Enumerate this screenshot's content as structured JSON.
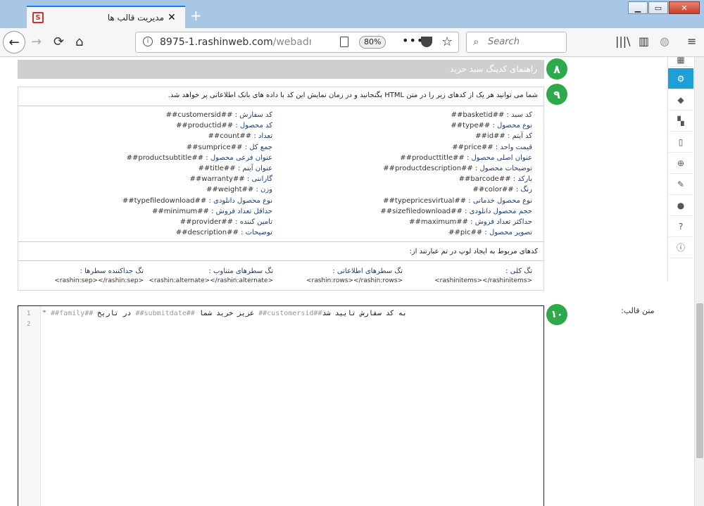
{
  "browser": {
    "tab_title": "مدیریت قالب ها",
    "tab_close": "✕",
    "new_tab": "+",
    "url_host": "8975-1.rashinweb.com",
    "url_path": "/webadmin/",
    "zoom": "80%",
    "search_placeholder": "Search",
    "win_min": "▁",
    "win_max": "▭",
    "win_close": "✕"
  },
  "panel": {
    "header_title": "راهنمای کدینگ سبد خرید",
    "step_8": "۸",
    "step_9": "۹",
    "step_10": "۱۰",
    "intro": "شما می توانید هر یک از کدهای زیر را در متن HTML بگنجانید و در زمان نمایش این کد با داده های بانک اطلاعاتی پر خواهد شد.",
    "codes_right": [
      {
        "label": "کد سبد :",
        "code": "##basketid##"
      },
      {
        "label": "نوع محصول :",
        "code": "##type##"
      },
      {
        "label": "کد آیتم :",
        "code": "##id##"
      },
      {
        "label": "قیمت واحد :",
        "code": "##price##"
      },
      {
        "label": "عنوان اصلی محصول :",
        "code": "##producttitle##"
      },
      {
        "label": "توضیحات محصول :",
        "code": "##productdescription##"
      },
      {
        "label": "بارکد :",
        "code": "##barcode##"
      },
      {
        "label": "رنگ :",
        "code": "##color##"
      },
      {
        "label": "نوع محصول خدماتی :",
        "code": "##typepricesvirtual##"
      },
      {
        "label": "حجم محصول دانلودی :",
        "code": "##sizefiledownload##"
      },
      {
        "label": "حداکثر تعداد فروش :",
        "code": "##maximum##"
      },
      {
        "label": "تصویر محصول :",
        "code": "##pic##"
      }
    ],
    "codes_left": [
      {
        "label": "کد سفارش :",
        "code": "##customersid##"
      },
      {
        "label": "کد محصول :",
        "code": "##productid##"
      },
      {
        "label": "تعداد :",
        "code": "##count##"
      },
      {
        "label": "جمع کل :",
        "code": "##sumprice##"
      },
      {
        "label": "عنوان فرعی محصول :",
        "code": "##productsubtitle##"
      },
      {
        "label": "عنوان آیتم :",
        "code": "##title##"
      },
      {
        "label": "گارانتی :",
        "code": "##warranty##"
      },
      {
        "label": "وزن :",
        "code": "##weight##"
      },
      {
        "label": "نوع محصول دانلودی :",
        "code": "##typefiledownload##"
      },
      {
        "label": "حداقل تعداد فروش :",
        "code": "##minimum##"
      },
      {
        "label": "تامین کننده :",
        "code": "##provider##"
      },
      {
        "label": "توضیحات :",
        "code": "##description##"
      }
    ],
    "loop_title": "کدهای مربوط به ایجاد لوپ در تم عبارتند از:",
    "loop_tags": [
      {
        "label": "تگ کلی :",
        "code": "<rashinitems></rashinitems>"
      },
      {
        "label": "تگ سطرهای اطلاعاتی :",
        "code": "<rashin:rows></rashin:rows>"
      },
      {
        "label": "تگ سطرهای متناوب :",
        "code": "<rashin:alternate></rashin:alternate>"
      },
      {
        "label": "تگ جداکننده سطرها :",
        "code": "<rashin:sep></rashin:sep>"
      }
    ]
  },
  "editor": {
    "label": "متن قالب:",
    "line_numbers": [
      "1",
      "2"
    ],
    "quote": "\"",
    "var_family": "##family##",
    "text_date": " در تاریخ ",
    "var_submitdate": "##submitdate##",
    "text_dear": " عزیز خرید شما ",
    "var_customersid": "##customersid##",
    "text_confirm": "به کد سفارش ",
    "text_final": " تایید شد"
  }
}
